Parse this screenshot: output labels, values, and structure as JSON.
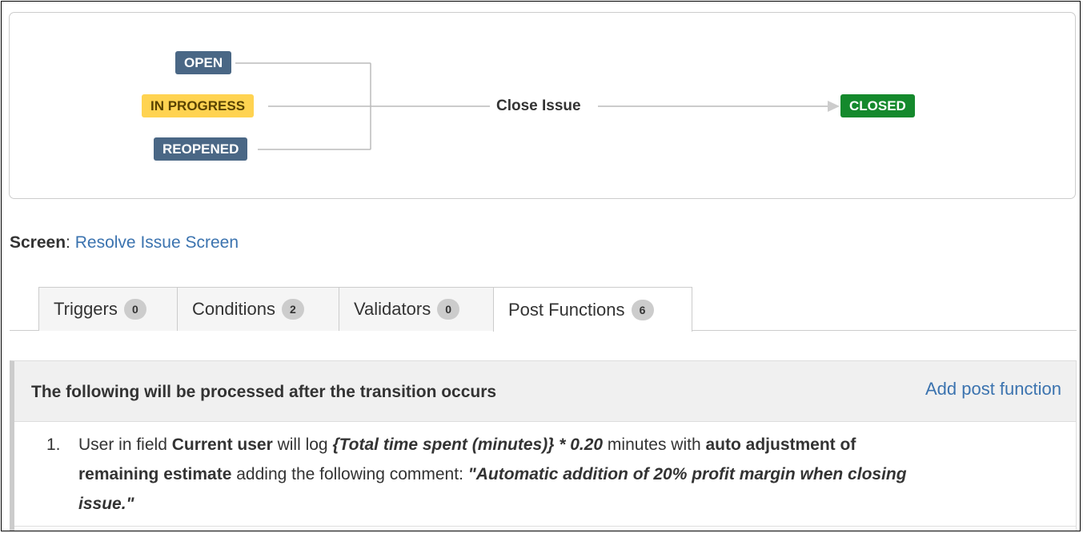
{
  "diagram": {
    "sources": [
      "OPEN",
      "IN PROGRESS",
      "REOPENED"
    ],
    "transition": "Close Issue",
    "target": "CLOSED",
    "colors": {
      "blue_status": "#4a6785",
      "yellow_status": "#ffd351",
      "green_status": "#14892c",
      "line": "#bbbbbb"
    }
  },
  "screen": {
    "label": "Screen",
    "separator": ":",
    "link": "Resolve Issue Screen"
  },
  "tabs": [
    {
      "label": "Triggers",
      "count": "0"
    },
    {
      "label": "Conditions",
      "count": "2"
    },
    {
      "label": "Validators",
      "count": "0"
    },
    {
      "label": "Post Functions",
      "count": "6"
    }
  ],
  "active_tab": "Post Functions",
  "panel": {
    "title": "The following will be processed after the transition occurs",
    "action": "Add post function",
    "items": [
      {
        "number": "1.",
        "parts": {
          "t1": "User in field ",
          "b1": "Current user",
          "t2": " will log ",
          "bi1": "{Total time spent (minutes)} * 0.20",
          "t3": " minutes with ",
          "b2": "auto adjustment of remaining estimate",
          "t4": " adding the following comment: ",
          "bi2": "\"Automatic addition of 20% profit margin when closing issue.\""
        }
      }
    ]
  }
}
